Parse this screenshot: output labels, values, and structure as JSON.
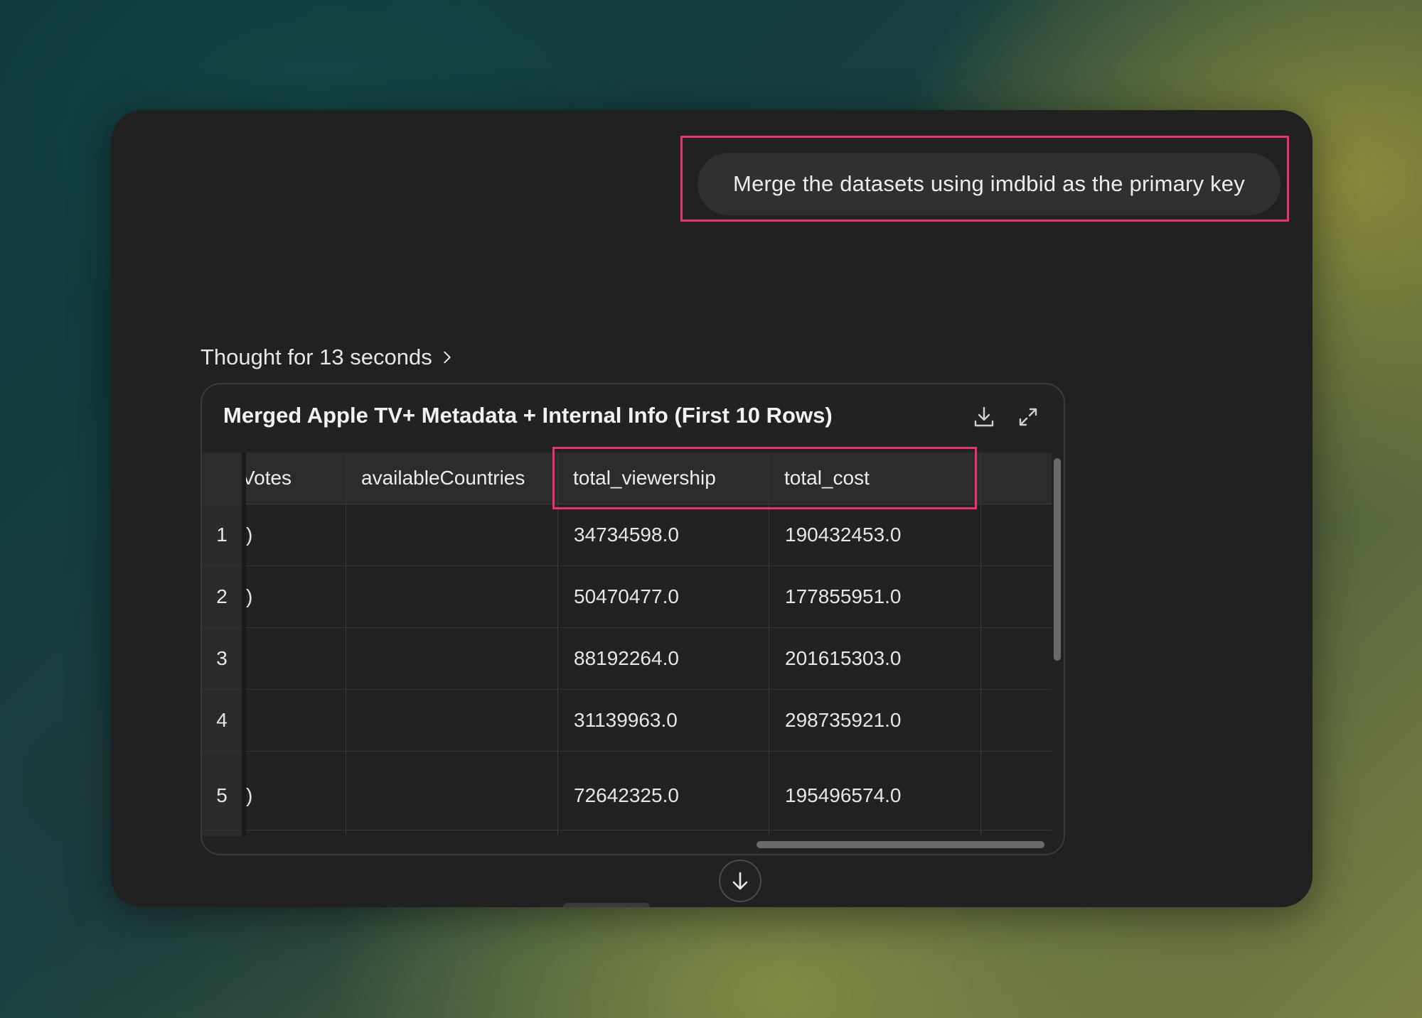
{
  "chat": {
    "user_message": "Merge the datasets using imdbid as the primary key",
    "thought_label": "Thought for 13 seconds"
  },
  "table": {
    "title": "Merged Apple TV+ Metadata + Internal Info (First 10 Rows)",
    "columns": [
      "Votes",
      "availableCountries",
      "total_viewership",
      "total_cost"
    ],
    "rows": [
      {
        "index": "1",
        "partial": ")",
        "availableCountries": "",
        "total_viewership": "34734598.0",
        "total_cost": "190432453.0"
      },
      {
        "index": "2",
        "partial": ")",
        "availableCountries": "",
        "total_viewership": "50470477.0",
        "total_cost": "177855951.0"
      },
      {
        "index": "3",
        "partial": "",
        "availableCountries": "",
        "total_viewership": "88192264.0",
        "total_cost": "201615303.0"
      },
      {
        "index": "4",
        "partial": "",
        "availableCountries": "",
        "total_viewership": "31139963.0",
        "total_cost": "298735921.0"
      },
      {
        "index": "5",
        "partial": ")",
        "availableCountries": "",
        "total_viewership": "72642325.0",
        "total_cost": "195496574.0"
      }
    ]
  },
  "icons": {
    "download": "download-icon",
    "expand": "expand-icon",
    "thought_chevron": "chevron-right-icon",
    "scroll_down": "arrow-down-icon"
  },
  "colors": {
    "highlight": "#e8336e",
    "window_bg": "#212121",
    "bubble_bg": "#303030"
  }
}
